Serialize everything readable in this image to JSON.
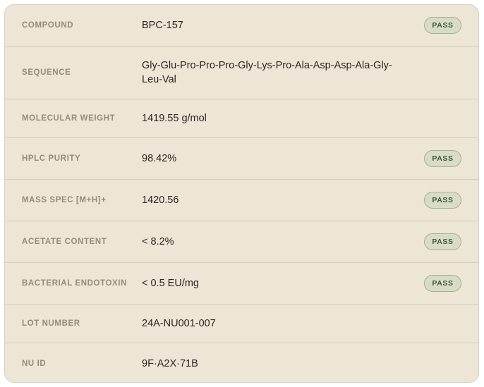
{
  "rows": [
    {
      "label": "COMPOUND",
      "value": "BPC-157",
      "status": "PASS"
    },
    {
      "label": "SEQUENCE",
      "value": "Gly-Glu-Pro-Pro-Pro-Gly-Lys-Pro-Ala-Asp-Asp-Ala-Gly-Leu-Val",
      "status": null
    },
    {
      "label": "MOLECULAR WEIGHT",
      "value": "1419.55 g/mol",
      "status": null
    },
    {
      "label": "HPLC PURITY",
      "value": "98.42%",
      "status": "PASS"
    },
    {
      "label": "MASS SPEC [M+H]+",
      "value": "1420.56",
      "status": "PASS"
    },
    {
      "label": "ACETATE CONTENT",
      "value": "< 8.2%",
      "status": "PASS"
    },
    {
      "label": "BACTERIAL ENDOTOXIN",
      "value": "< 0.5 EU/mg",
      "status": "PASS"
    },
    {
      "label": "LOT NUMBER",
      "value": "24A-NU001-007",
      "status": null
    },
    {
      "label": "NU ID",
      "value": "9F·A2X·71B",
      "status": null
    }
  ],
  "colors": {
    "card_bg": "#ede5d6",
    "label": "#948b7d",
    "value": "#2a2620",
    "pass_badge_bg": "#d8dcc6",
    "pass_badge_text": "#3d5a38"
  }
}
